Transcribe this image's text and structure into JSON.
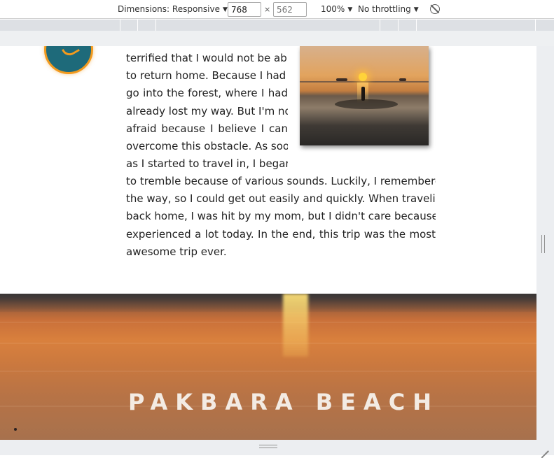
{
  "devtools": {
    "dimensions_label": "Dimensions: Responsive",
    "width_value": "768",
    "height_placeholder": "562",
    "times_symbol": "×",
    "zoom": "100%",
    "throttling": "No throttling",
    "caret": "▼"
  },
  "article": {
    "column_a_lines": [
      "terrified that I would not be able",
      "to return home. Because I had to",
      "go into the forest, where I had",
      "already lost my way. But I'm not",
      "afraid because I believe I can",
      "overcome this obstacle. As soon",
      "as I started to travel in, I began"
    ],
    "column_b_lines": [
      "to tremble because of various sounds. Luckily, I remembered",
      "the way, so I could get out easily and quickly. When traveling",
      "back home, I was hit by my mom, but I didn't care because I've",
      "experienced a lot today. In the end, this trip was the most",
      "awesome trip ever."
    ]
  },
  "banner": {
    "title": "PAKBARA BEACH"
  },
  "colors": {
    "avatar_fill": "#1e6a7a",
    "avatar_ring": "#f29a1e",
    "banner_text": "#f3ebe3"
  }
}
